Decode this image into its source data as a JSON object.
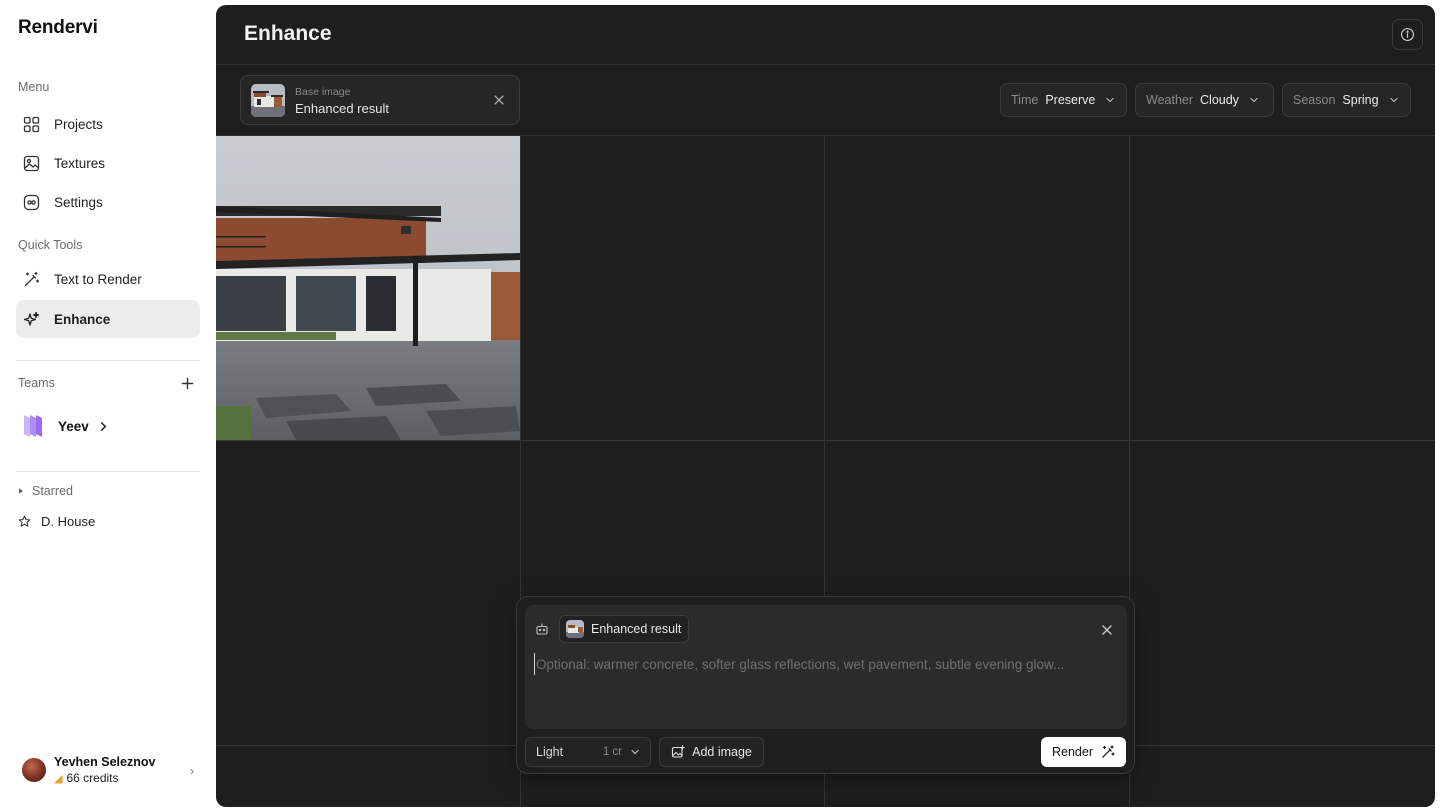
{
  "app": {
    "name": "Rendervi"
  },
  "sidebar": {
    "menu_label": "Menu",
    "menu_items": [
      {
        "label": "Projects",
        "icon": "grid-icon"
      },
      {
        "label": "Textures",
        "icon": "image-icon"
      },
      {
        "label": "Settings",
        "icon": "settings-icon"
      }
    ],
    "quick_tools_label": "Quick Tools",
    "quick_tools": [
      {
        "label": "Text to Render",
        "icon": "magic-wand-icon",
        "active": false
      },
      {
        "label": "Enhance",
        "icon": "sparkles-icon",
        "active": true
      }
    ],
    "teams_label": "Teams",
    "team": {
      "name": "Yeev"
    },
    "starred_label": "Starred",
    "starred_items": [
      {
        "label": "D. House"
      }
    ],
    "user": {
      "name": "Yevhen Seleznov",
      "credits": "66 credits"
    }
  },
  "header": {
    "title": "Enhance"
  },
  "toolbar": {
    "base_chip": {
      "sublabel": "Base image",
      "label": "Enhanced result"
    },
    "selects": [
      {
        "label": "Time",
        "value": "Preserve"
      },
      {
        "label": "Weather",
        "value": "Cloudy"
      },
      {
        "label": "Season",
        "value": "Spring"
      }
    ]
  },
  "composer": {
    "reference_label": "Enhanced result",
    "placeholder": "Optional: warmer concrete, softer glass reflections, wet pavement, subtle evening glow...",
    "value": "",
    "quality": {
      "value": "Light",
      "cost": "1 cr"
    },
    "add_image_label": "Add image",
    "render_label": "Render"
  },
  "colors": {
    "panel_bg": "#1e1e1e",
    "sidebar_bg": "#ffffff",
    "active_nav_bg": "#ececec",
    "team_accent": "#9b6cf2",
    "credit_accent": "#f0a020"
  }
}
